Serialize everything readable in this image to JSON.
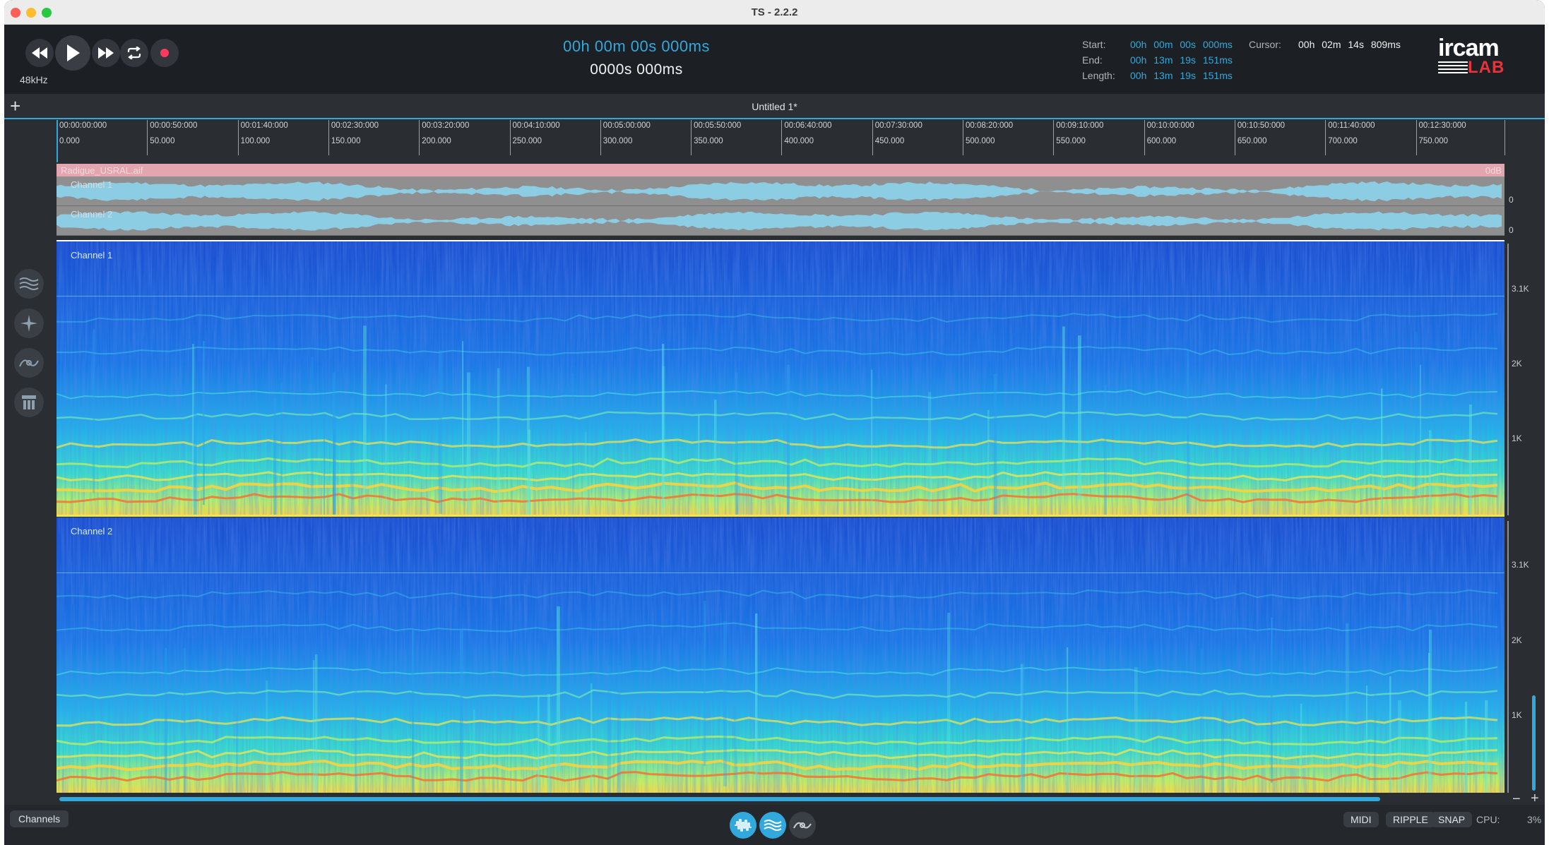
{
  "window": {
    "title": "TS - 2.2.2"
  },
  "transport": {
    "sample_rate": "48kHz",
    "buttons": [
      "rewind-icon",
      "play-icon",
      "fast-forward-icon",
      "loop-icon",
      "record-icon"
    ]
  },
  "time_display": {
    "timecode": "00h  00m  00s   000ms",
    "samples": "0000s   000ms"
  },
  "selection": {
    "start_label": "Start:",
    "start_value": "00h 00m 00s 000ms",
    "end_label": "End:",
    "end_value": "00h 13m 19s 151ms",
    "length_label": "Length:",
    "length_value": "00h 13m 19s 151ms",
    "cursor_label": "Cursor:",
    "cursor_value": "00h 02m 14s 809ms"
  },
  "logo": {
    "top": "ircam",
    "bottom": "LAB"
  },
  "tabs": {
    "add_label": "+",
    "active_title": "Untitled 1*"
  },
  "ruler": {
    "ticks": [
      {
        "time": "00:00:00:000",
        "sec": "0.000"
      },
      {
        "time": "00:00:50:000",
        "sec": "50.000"
      },
      {
        "time": "00:01:40:000",
        "sec": "100.000"
      },
      {
        "time": "00:02:30:000",
        "sec": "150.000"
      },
      {
        "time": "00:03:20:000",
        "sec": "200.000"
      },
      {
        "time": "00:04:10:000",
        "sec": "250.000"
      },
      {
        "time": "00:05:00:000",
        "sec": "300.000"
      },
      {
        "time": "00:05:50:000",
        "sec": "350.000"
      },
      {
        "time": "00:06:40:000",
        "sec": "400.000"
      },
      {
        "time": "00:07:30:000",
        "sec": "450.000"
      },
      {
        "time": "00:08:20:000",
        "sec": "500.000"
      },
      {
        "time": "00:09:10:000",
        "sec": "550.000"
      },
      {
        "time": "00:10:00:000",
        "sec": "600.000"
      },
      {
        "time": "00:10:50:000",
        "sec": "650.000"
      },
      {
        "time": "00:11:40:000",
        "sec": "700.000"
      },
      {
        "time": "00:12:30:000",
        "sec": "750.000"
      }
    ]
  },
  "file": {
    "name": "Radigue_USRAL.aif",
    "gain": "0dB"
  },
  "waveform": {
    "channel_1": "Channel 1",
    "channel_2": "Channel 2",
    "scale_1": "0",
    "scale_2": "0",
    "color": "#8ccde3"
  },
  "spectrogram": {
    "channel_1": "Channel 1",
    "channel_2": "Channel 2",
    "freq_labels": [
      "3.1K",
      "2K",
      "1K"
    ]
  },
  "left_tools": [
    "spectrum-layers-icon",
    "sparkle-icon",
    "curve-tool-icon",
    "stack-icon"
  ],
  "bottom": {
    "channels_button": "Channels",
    "view_buttons": [
      "waveform-view-icon",
      "spectrum-view-icon",
      "curve-view-icon"
    ],
    "midi": "MIDI",
    "ripple": "RIPPLE",
    "snap": "SNAP",
    "cpu_label": "CPU:",
    "cpu_value": "3%"
  },
  "zoom": {
    "minus": "−",
    "plus": "+"
  },
  "colors": {
    "accent": "#31a9dd",
    "file_bar": "#e3a6b0",
    "background": "#2a2e33"
  }
}
